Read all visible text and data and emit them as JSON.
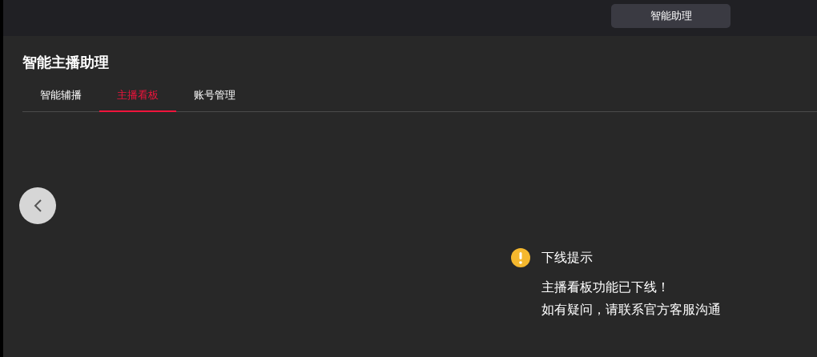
{
  "header": {
    "button": "智能助理"
  },
  "title": "智能主播助理",
  "tabs": [
    {
      "label": "智能辅播",
      "selected": false
    },
    {
      "label": "主播看板",
      "selected": true
    },
    {
      "label": "账号管理",
      "selected": false
    }
  ],
  "notice": {
    "title": "下线提示",
    "lines": [
      "主播看板功能已下线！",
      "如有疑问，请联系官方客服沟通"
    ]
  }
}
